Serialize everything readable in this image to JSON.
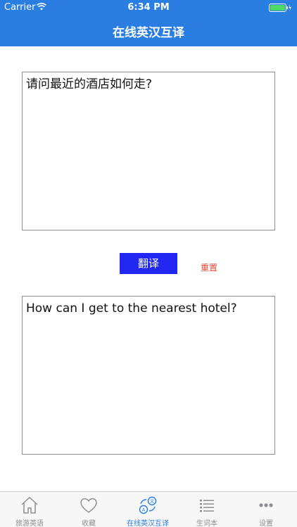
{
  "status": {
    "carrier": "Carrier",
    "time": "6:34 PM"
  },
  "nav": {
    "title": "在线英汉互译"
  },
  "source": {
    "text": "请问最近的酒店如何走?"
  },
  "actions": {
    "translate_label": "翻译",
    "reset_label": "重置"
  },
  "result": {
    "text": "How can I get to the nearest hotel?"
  },
  "tabbar": {
    "items": [
      {
        "label": "旅游英语",
        "icon": "home-icon"
      },
      {
        "label": "收藏",
        "icon": "heart-icon"
      },
      {
        "label": "在线英汉互译",
        "icon": "translate-icon",
        "active": true
      },
      {
        "label": "生词本",
        "icon": "list-icon"
      },
      {
        "label": "设置",
        "icon": "more-icon"
      }
    ]
  },
  "colors": {
    "accent": "#2a7de1",
    "button": "#2227f2",
    "reset": "#e94335"
  }
}
